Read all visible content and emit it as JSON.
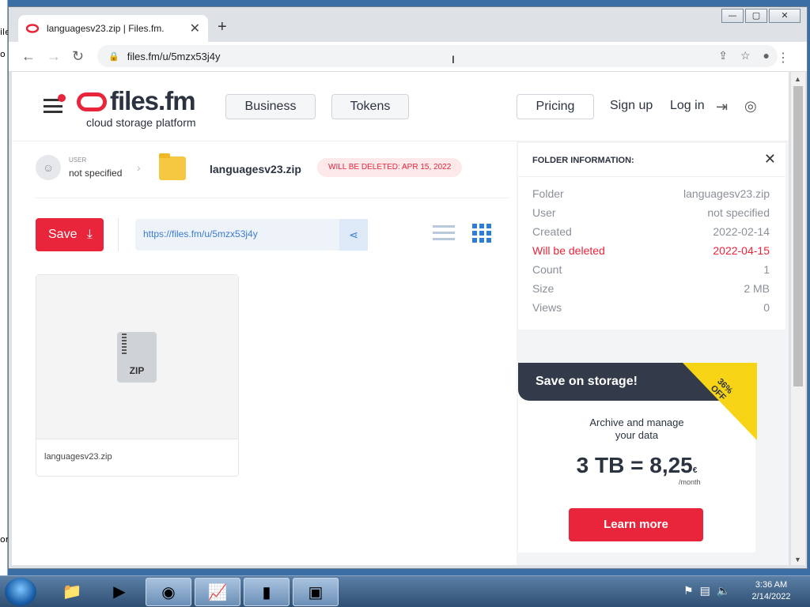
{
  "desktop": {
    "fragments": [
      "ile",
      "o",
      "or"
    ]
  },
  "window": {
    "controls": [
      "—",
      "▢",
      "✕"
    ]
  },
  "browser": {
    "tab_title": "languagesv23.zip | Files.fm.",
    "tab_close": "✕",
    "new_tab": "+",
    "url": "files.fm/u/5mzx53j4y"
  },
  "header": {
    "logo_name": "files.fm",
    "logo_tagline": "cloud storage platform",
    "business": "Business",
    "tokens": "Tokens",
    "pricing": "Pricing",
    "signup": "Sign up",
    "login": "Log in"
  },
  "breadcrumb": {
    "user_label": "USER",
    "user_value": "not specified",
    "folder_name": "languagesv23.zip",
    "delete_badge": "WILL BE DELETED: APR 15, 2022"
  },
  "toolbar": {
    "save": "Save",
    "share_url": "https://files.fm/u/5mzx53j4y"
  },
  "file": {
    "type": "ZIP",
    "name": "languagesv23.zip"
  },
  "folder_info": {
    "title": "FOLDER INFORMATION:",
    "rows": [
      {
        "key": "Folder",
        "value": "languagesv23.zip"
      },
      {
        "key": "User",
        "value": "not specified"
      },
      {
        "key": "Created",
        "value": "2022-02-14"
      },
      {
        "key": "Will be deleted",
        "value": "2022-04-15"
      },
      {
        "key": "Count",
        "value": "1"
      },
      {
        "key": "Size",
        "value": "2 MB"
      },
      {
        "key": "Views",
        "value": "0"
      }
    ]
  },
  "promo": {
    "banner": "Save on storage!",
    "discount": "36%",
    "discount_suffix": "OFF",
    "text_line1": "Archive and manage",
    "text_line2": "your data",
    "price": "3 TB = 8,25",
    "currency": "€",
    "period": "/month",
    "cta": "Learn more"
  },
  "taskbar": {
    "time": "3:36 AM",
    "date": "2/14/2022"
  },
  "colors": {
    "brand_red": "#e8253b",
    "dark": "#2b3240",
    "link_blue": "#3a7bd5",
    "promo_yellow": "#f7d516"
  }
}
